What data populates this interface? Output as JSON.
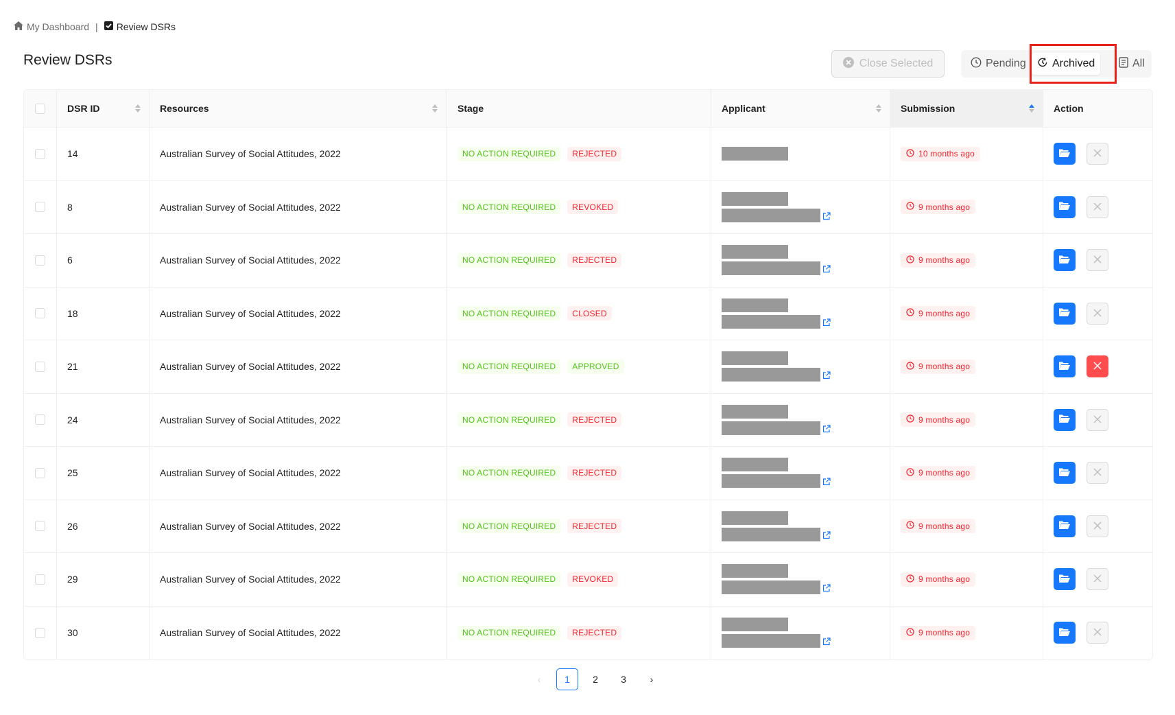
{
  "breadcrumb": {
    "home_label": "My Dashboard",
    "home_icon": "home-icon",
    "separator": "|",
    "current_label": "Review DSRs",
    "current_icon": "checkbox-icon"
  },
  "page": {
    "title": "Review DSRs"
  },
  "toolbar": {
    "close_selected_label": "Close Selected",
    "filters": [
      {
        "label": "Pending",
        "icon": "clock-icon",
        "active": false
      },
      {
        "label": "Archived",
        "icon": "history-icon",
        "active": true
      },
      {
        "label": "All",
        "icon": "document-icon",
        "active": false
      }
    ]
  },
  "table": {
    "columns": [
      "DSR ID",
      "Resources",
      "Stage",
      "Applicant",
      "Submission",
      "Action"
    ],
    "sorted_column": "Submission",
    "rows": [
      {
        "id": "14",
        "resource": "Australian Survey of Social Attitudes, 2022",
        "stage": "NO ACTION REQUIRED",
        "status": "REJECTED",
        "submitted": "10 months ago",
        "applicant_link": false,
        "close_danger": false
      },
      {
        "id": "8",
        "resource": "Australian Survey of Social Attitudes, 2022",
        "stage": "NO ACTION REQUIRED",
        "status": "REVOKED",
        "submitted": "9 months ago",
        "applicant_link": true,
        "close_danger": false
      },
      {
        "id": "6",
        "resource": "Australian Survey of Social Attitudes, 2022",
        "stage": "NO ACTION REQUIRED",
        "status": "REJECTED",
        "submitted": "9 months ago",
        "applicant_link": true,
        "close_danger": false
      },
      {
        "id": "18",
        "resource": "Australian Survey of Social Attitudes, 2022",
        "stage": "NO ACTION REQUIRED",
        "status": "CLOSED",
        "submitted": "9 months ago",
        "applicant_link": true,
        "close_danger": false
      },
      {
        "id": "21",
        "resource": "Australian Survey of Social Attitudes, 2022",
        "stage": "NO ACTION REQUIRED",
        "status": "APPROVED",
        "submitted": "9 months ago",
        "applicant_link": true,
        "close_danger": true
      },
      {
        "id": "24",
        "resource": "Australian Survey of Social Attitudes, 2022",
        "stage": "NO ACTION REQUIRED",
        "status": "REJECTED",
        "submitted": "9 months ago",
        "applicant_link": true,
        "close_danger": false
      },
      {
        "id": "25",
        "resource": "Australian Survey of Social Attitudes, 2022",
        "stage": "NO ACTION REQUIRED",
        "status": "REJECTED",
        "submitted": "9 months ago",
        "applicant_link": true,
        "close_danger": false
      },
      {
        "id": "26",
        "resource": "Australian Survey of Social Attitudes, 2022",
        "stage": "NO ACTION REQUIRED",
        "status": "REJECTED",
        "submitted": "9 months ago",
        "applicant_link": true,
        "close_danger": false
      },
      {
        "id": "29",
        "resource": "Australian Survey of Social Attitudes, 2022",
        "stage": "NO ACTION REQUIRED",
        "status": "REVOKED",
        "submitted": "9 months ago",
        "applicant_link": true,
        "close_danger": false
      },
      {
        "id": "30",
        "resource": "Australian Survey of Social Attitudes, 2022",
        "stage": "NO ACTION REQUIRED",
        "status": "REJECTED",
        "submitted": "9 months ago",
        "applicant_link": true,
        "close_danger": false
      }
    ]
  },
  "pagination": {
    "prev_label": "‹",
    "next_label": "›",
    "pages": [
      "1",
      "2",
      "3"
    ],
    "current": "1"
  },
  "colors": {
    "primary": "#1677ff",
    "danger": "#ff4d4f",
    "success_text": "#52c41a",
    "error_text": "#f5222d",
    "highlight_box": "#e8231b"
  }
}
